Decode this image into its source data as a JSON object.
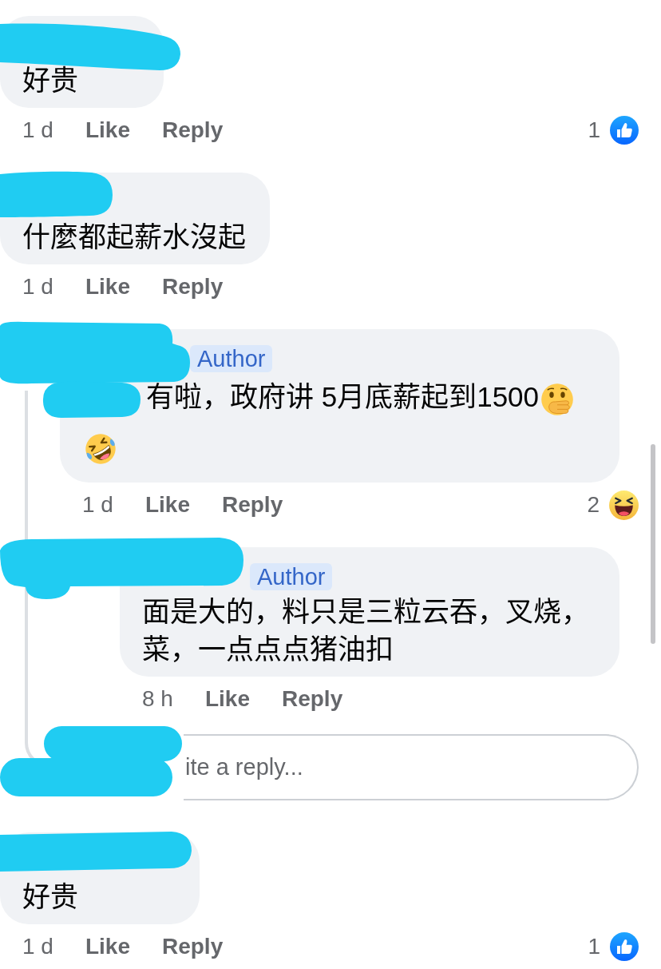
{
  "comments": [
    {
      "redacted": true,
      "text_parts": [
        {
          "kind": "text",
          "text": "好贵"
        }
      ],
      "time": "1 d",
      "actions": [
        "Like",
        "Reply"
      ],
      "reaction": {
        "kind": "like",
        "count": "1"
      }
    },
    {
      "redacted": true,
      "text_parts": [
        {
          "kind": "text",
          "text": "什麼都起薪水沒起"
        }
      ],
      "time": "1 d",
      "actions": [
        "Like",
        "Reply"
      ],
      "replies": [
        {
          "redacted": true,
          "badge": "Author",
          "text_parts": [
            {
              "kind": "mention"
            },
            {
              "kind": "text",
              "text": "有啦，政府讲 5月底薪起到1500"
            },
            {
              "kind": "gasp"
            },
            {
              "kind": "rofl"
            }
          ],
          "time": "1 d",
          "actions": [
            "Like",
            "Reply"
          ],
          "reaction": {
            "kind": "haha",
            "count": "2"
          },
          "replies": [
            {
              "redacted": true,
              "badge": "Author",
              "text_parts": [
                {
                  "kind": "text",
                  "text": "面是大的，料只是三粒云吞，叉烧，菜，一点点点猪油扣"
                }
              ],
              "time": "8 h",
              "actions": [
                "Like",
                "Reply"
              ]
            }
          ],
          "reply_field": {
            "placeholder": "ite a reply...",
            "redacted": true
          }
        }
      ]
    },
    {
      "redacted": true,
      "text_parts": [
        {
          "kind": "text",
          "text": "好贵"
        }
      ],
      "time": "1 d",
      "actions": [
        "Like",
        "Reply"
      ],
      "reaction": {
        "kind": "like",
        "count": "1"
      }
    }
  ]
}
